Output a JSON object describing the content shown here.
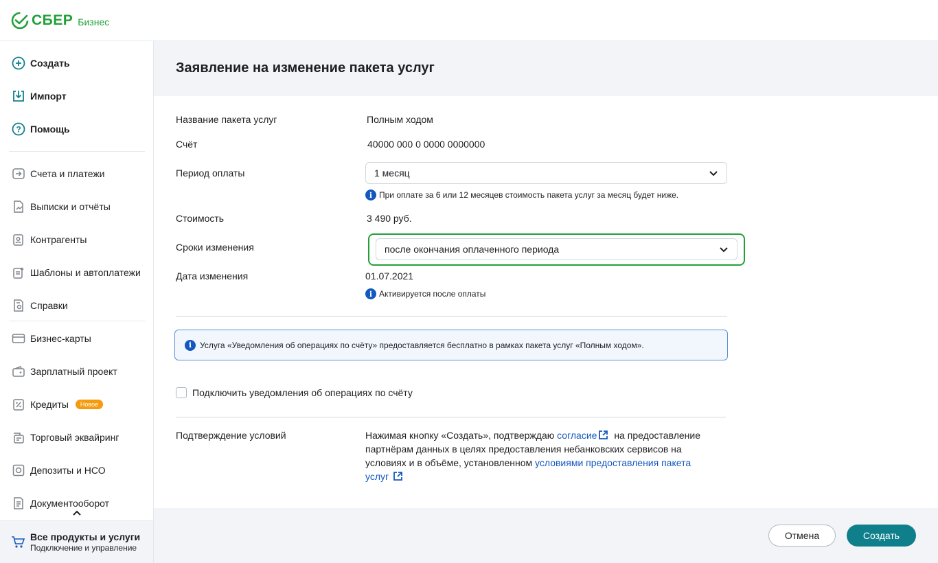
{
  "brand": {
    "name": "СБЕР",
    "sub": "Бизнес"
  },
  "sidebar": {
    "actions": [
      {
        "label": "Создать",
        "icon": "plus-circle-icon"
      },
      {
        "label": "Импорт",
        "icon": "import-icon"
      },
      {
        "label": "Помощь",
        "icon": "help-circle-icon"
      }
    ],
    "items": [
      {
        "label": "Счета и платежи",
        "icon": "arrow-box-icon"
      },
      {
        "label": "Выписки и отчёты",
        "icon": "statement-icon"
      },
      {
        "label": "Контрагенты",
        "icon": "contacts-icon"
      },
      {
        "label": "Шаблоны и автоплатежи",
        "icon": "template-icon"
      },
      {
        "label": "Справки",
        "icon": "certificate-icon"
      },
      {
        "label": "Бизнес-карты",
        "icon": "card-icon"
      },
      {
        "label": "Зарплатный проект",
        "icon": "wallet-icon"
      },
      {
        "label": "Кредиты",
        "icon": "percent-icon",
        "badge": "Новое"
      },
      {
        "label": "Торговый эквайринг",
        "icon": "terminal-icon"
      },
      {
        "label": "Депозиты и НСО",
        "icon": "safe-icon"
      },
      {
        "label": "Документооборот",
        "icon": "document-icon"
      }
    ],
    "footer": {
      "title": "Все продукты и услуги",
      "subtitle": "Подключение и управление"
    }
  },
  "page": {
    "title": "Заявление на изменение пакета услуг",
    "fields": {
      "package_label": "Название пакета услуг",
      "package_value": "Полным ходом",
      "account_label": "Счёт",
      "account_value": "40000 000 0 0000 0000000",
      "period_label": "Период оплаты",
      "period_value": "1 месяц",
      "period_hint": "При оплате за 6 или 12 месяцев стоимость пакета услуг за месяц будет ниже.",
      "cost_label": "Стоимость",
      "cost_value": "3 490 руб.",
      "terms_label": "Сроки изменения",
      "terms_value": "после окончания оплаченного периода",
      "date_label": "Дата изменения",
      "date_value": "01.07.2021",
      "date_hint": "Активируется после оплаты"
    },
    "notice": "Услуга «Уведомления об операциях по счёту» предоставляется бесплатно в рамках пакета услуг «Полным ходом».",
    "checkbox_label": "Подключить уведомления об операциях по счёту",
    "checkbox_checked": false,
    "confirm_label": "Подтверждение условий",
    "consent": {
      "text1": "Нажимая кнопку «Создать», подтверждаю ",
      "link1": "согласие",
      "text2": " на предоставление партнёрам данных в целях предоставления небанковских сервисов на условиях и в объёме, установленном ",
      "link2": "условиями предоставления пакета услуг"
    }
  },
  "buttons": {
    "cancel": "Отмена",
    "create": "Создать"
  },
  "colors": {
    "brand_green": "#21a038",
    "primary": "#107f8c",
    "link": "#1358bf",
    "badge": "#f59b0e"
  }
}
